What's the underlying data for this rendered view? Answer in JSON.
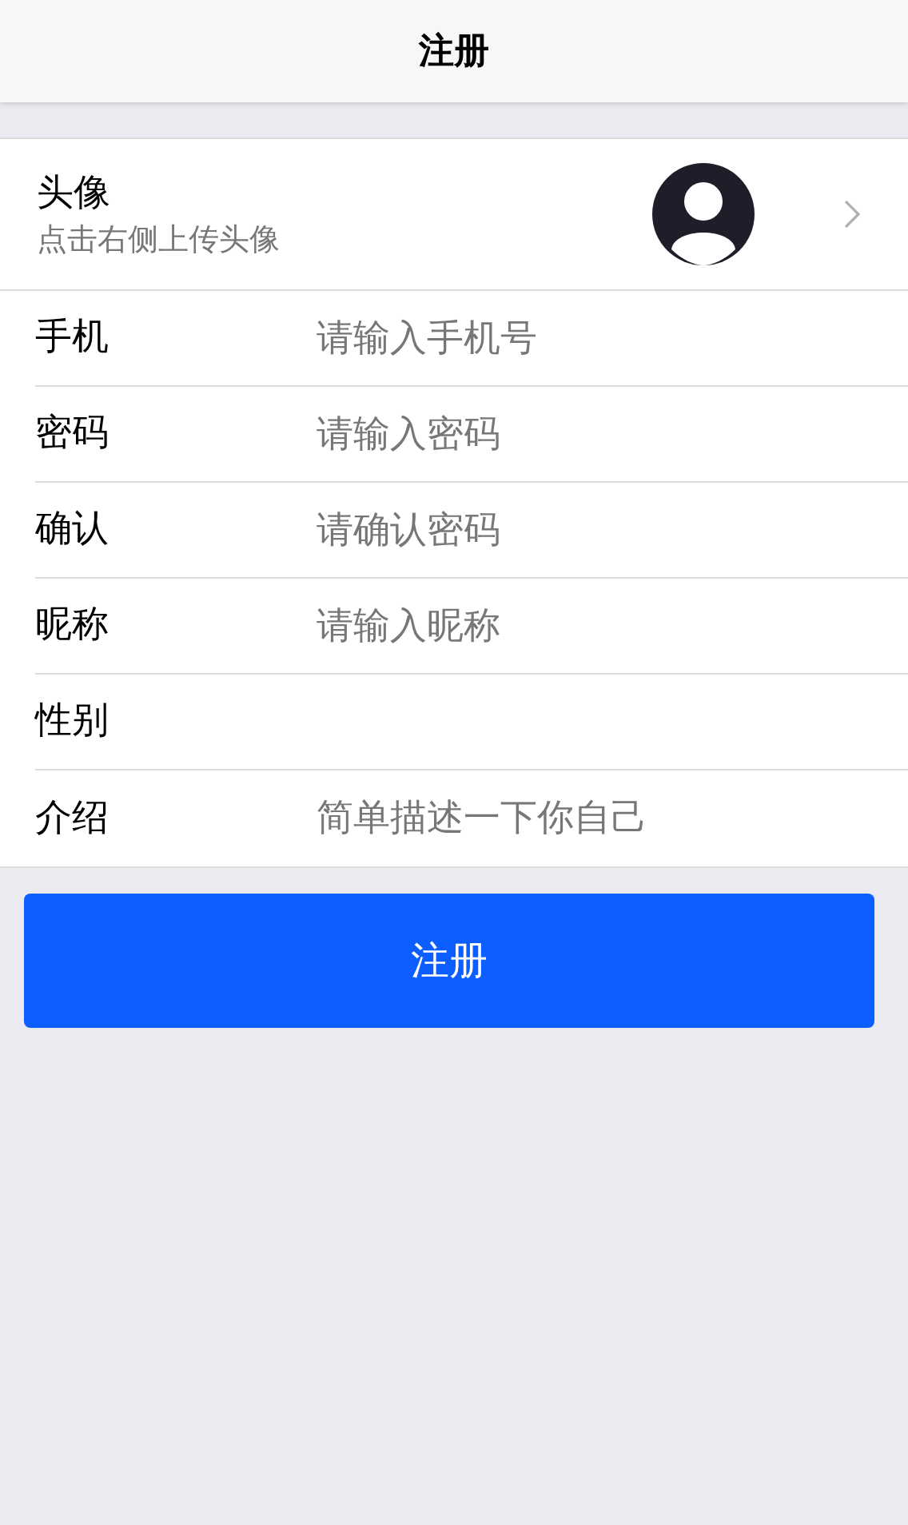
{
  "header": {
    "title": "注册"
  },
  "avatar_row": {
    "label": "头像",
    "hint": "点击右侧上传头像"
  },
  "fields": [
    {
      "label": "手机",
      "placeholder": "请输入手机号"
    },
    {
      "label": "密码",
      "placeholder": "请输入密码"
    },
    {
      "label": "确认",
      "placeholder": "请确认密码"
    },
    {
      "label": "昵称",
      "placeholder": "请输入昵称"
    },
    {
      "label": "性别"
    },
    {
      "label": "介绍",
      "placeholder": "简单描述一下你自己"
    }
  ],
  "submit_button": {
    "label": "注册"
  }
}
